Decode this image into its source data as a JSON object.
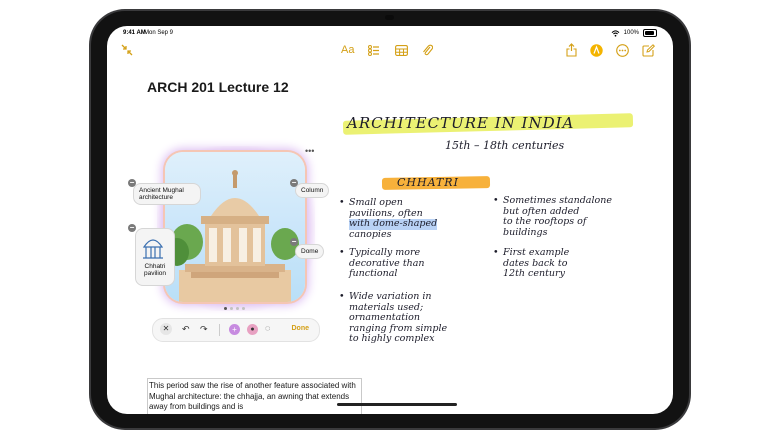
{
  "status_bar": {
    "time": "9:41 AM",
    "date": "Mon Sep 9",
    "battery": "100%",
    "battery_level": 1.0
  },
  "toolbar": {
    "collapse_icon": "collapse-arrows-icon",
    "format_label": "Aa",
    "checklist_icon": "checklist-icon",
    "table_icon": "table-icon",
    "attachment_icon": "paperclip-icon",
    "share_icon": "share-icon",
    "markup_icon": "pencil-tip-circle-icon",
    "more_icon": "ellipsis-circle-icon",
    "compose_icon": "compose-icon"
  },
  "note": {
    "title": "ARCH 201 Lecture 12",
    "handwriting": {
      "heading": "ARCHITECTURE IN INDIA",
      "centuries": "15th – 18th centuries",
      "subheading": "CHHATRI",
      "left_bullets": [
        [
          "Small open",
          "pavilions, often",
          "with dome-shaped",
          "canopies"
        ],
        [
          "Typically more",
          "decorative than",
          "functional"
        ],
        [
          "Wide variation in",
          "materials used;",
          "ornamentation",
          "ranging from simple",
          "to highly complex"
        ]
      ],
      "right_bullets": [
        [
          "Sometimes standalone",
          "but often added",
          "to the rooftops of",
          "buildings"
        ],
        [
          "First example",
          "dates back to",
          "12th century"
        ]
      ]
    },
    "image_card": {
      "labels": {
        "ancient_mughal": "Ancient Mughal architecture",
        "column": "Column",
        "dome": "Dome",
        "chhatri_pavilion": "Chhatri pavilion"
      },
      "page_dots": 4,
      "active_dot": 0
    },
    "edit_bar": {
      "done_label": "Done"
    },
    "paragraph": "This period saw the rise of another feature associated with Mughal architecture: the chhajja, an awning that extends away from buildings and is"
  },
  "colors": {
    "accent": "#d4a017",
    "highlight_yellow": "#e8ee5a",
    "highlight_orange": "#f7b13b",
    "highlight_blue": "#b9d2f5"
  }
}
